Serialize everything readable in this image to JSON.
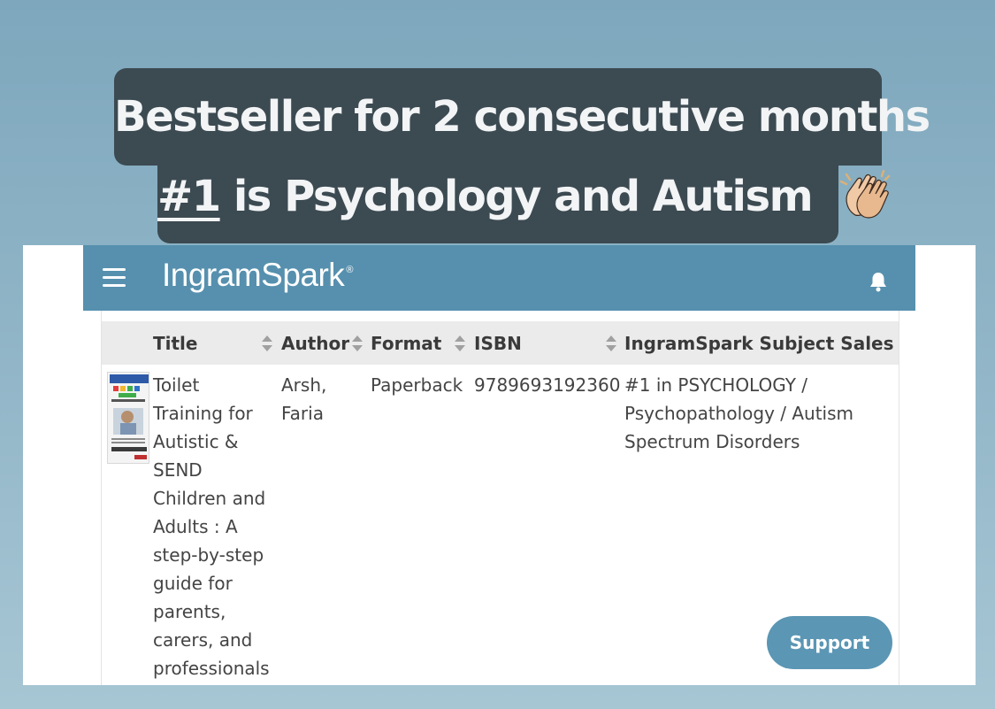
{
  "caption": {
    "line1": "Bestseller for 2 consecutive months",
    "rank": "#1",
    "line2_rest": " is Psychology and Autism",
    "emoji": "clapping-hands"
  },
  "appbar": {
    "brand": "IngramSpark",
    "brand_mark": "®",
    "menu_icon": "hamburger-menu-icon",
    "notification_icon": "bell-icon",
    "color": "#5690ae"
  },
  "table": {
    "columns": [
      {
        "label": "Title"
      },
      {
        "label": "Author"
      },
      {
        "label": "Format"
      },
      {
        "label": "ISBN"
      },
      {
        "label": "IngramSpark Subject Sales Ra"
      }
    ],
    "rows": [
      {
        "title_lines": [
          "Toilet",
          "Training for",
          "Autistic &",
          "SEND",
          "Children and",
          "Adults : A",
          "step-by-step",
          "guide for",
          "parents,",
          "carers, and",
          "professionals"
        ],
        "author_lines": [
          "Arsh,",
          "Faria"
        ],
        "format": "Paperback",
        "isbn": "9789693192360",
        "rank_lines": [
          "#1 in PSYCHOLOGY /",
          "Psychopathology / Autism",
          "Spectrum Disorders"
        ]
      }
    ]
  },
  "support_button": {
    "label": "Support",
    "color": "#5b96b4"
  }
}
